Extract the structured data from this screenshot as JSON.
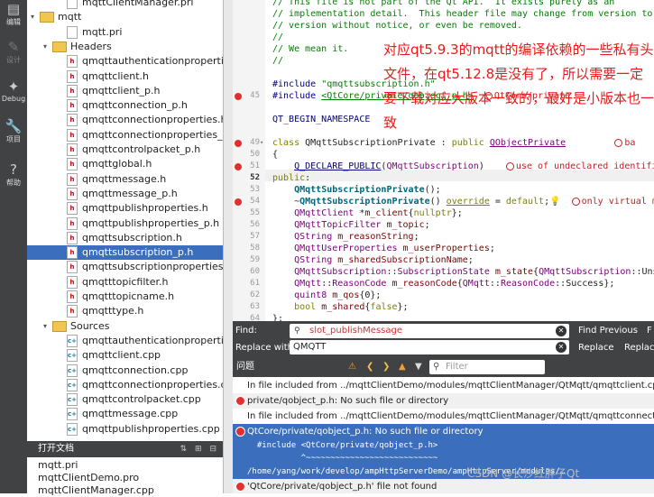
{
  "modebar": [
    {
      "label": "编辑",
      "icon": "▤"
    },
    {
      "label": "设计",
      "icon": "✎",
      "dim": true
    },
    {
      "label": "Debug",
      "icon": "✦"
    },
    {
      "label": "项目",
      "icon": "🔧"
    },
    {
      "label": "帮助",
      "icon": "?"
    }
  ],
  "tree": [
    {
      "text": "mqttClientManager.pri",
      "type": "pri",
      "indent": 3
    },
    {
      "text": "mqtt",
      "type": "folder",
      "indent": 1,
      "arrow": "▾"
    },
    {
      "text": "mqtt.pri",
      "type": "pri",
      "indent": 3
    },
    {
      "text": "Headers",
      "type": "folder",
      "indent": 2,
      "arrow": "▾"
    },
    {
      "text": "qmqttauthenticationproperties.h",
      "type": "h",
      "indent": 3
    },
    {
      "text": "qmqttclient.h",
      "type": "h",
      "indent": 3
    },
    {
      "text": "qmqttclient_p.h",
      "type": "h",
      "indent": 3
    },
    {
      "text": "qmqttconnection_p.h",
      "type": "h",
      "indent": 3
    },
    {
      "text": "qmqttconnectionproperties.h",
      "type": "h",
      "indent": 3
    },
    {
      "text": "qmqttconnectionproperties_p.h",
      "type": "h",
      "indent": 3
    },
    {
      "text": "qmqttcontrolpacket_p.h",
      "type": "h",
      "indent": 3
    },
    {
      "text": "qmqttglobal.h",
      "type": "h",
      "indent": 3
    },
    {
      "text": "qmqttmessage.h",
      "type": "h",
      "indent": 3
    },
    {
      "text": "qmqttmessage_p.h",
      "type": "h",
      "indent": 3
    },
    {
      "text": "qmqttpublishproperties.h",
      "type": "h",
      "indent": 3
    },
    {
      "text": "qmqttpublishproperties_p.h",
      "type": "h",
      "indent": 3
    },
    {
      "text": "qmqttsubscription.h",
      "type": "h",
      "indent": 3
    },
    {
      "text": "qmqttsubscription_p.h",
      "type": "h",
      "indent": 3,
      "selected": true
    },
    {
      "text": "qmqttsubscriptionproperties.h",
      "type": "h",
      "indent": 3
    },
    {
      "text": "qmqtttopicfilter.h",
      "type": "h",
      "indent": 3
    },
    {
      "text": "qmqtttopicname.h",
      "type": "h",
      "indent": 3
    },
    {
      "text": "qmqtttype.h",
      "type": "h",
      "indent": 3
    },
    {
      "text": "Sources",
      "type": "folder",
      "indent": 2,
      "arrow": "▾"
    },
    {
      "text": "qmqttauthenticationproperties.cpp",
      "type": "cpp",
      "indent": 3
    },
    {
      "text": "qmqttclient.cpp",
      "type": "cpp",
      "indent": 3
    },
    {
      "text": "qmqttconnection.cpp",
      "type": "cpp",
      "indent": 3
    },
    {
      "text": "qmqttconnectionproperties.cpp",
      "type": "cpp",
      "indent": 3
    },
    {
      "text": "qmqttcontrolpacket.cpp",
      "type": "cpp",
      "indent": 3
    },
    {
      "text": "qmqttmessage.cpp",
      "type": "cpp",
      "indent": 3
    },
    {
      "text": "qmqttpublishproperties.cpp",
      "type": "cpp",
      "indent": 3
    }
  ],
  "open_docs": {
    "title": "打开文档",
    "controls": "⇅ ⊞ ⊟",
    "items": [
      "mqtt.pri",
      "mqttClientDemo.pro",
      "mqttClientManager.cpp"
    ]
  },
  "editor": {
    "lines": [
      {
        "n": "",
        "html": "<span class='cm'>// This file is not part of the Qt API.  It exists purely as an</span>"
      },
      {
        "n": "",
        "html": "<span class='cm'>// implementation detail.  This header file may change from version to</span>"
      },
      {
        "n": "",
        "html": "<span class='cm'>// version without notice, or even be removed.</span>"
      },
      {
        "n": "",
        "html": "<span class='cm'>//</span>"
      },
      {
        "n": "",
        "html": "<span class='cm'>// We mean it.</span>"
      },
      {
        "n": "",
        "html": "<span class='cm'>//</span>"
      },
      {
        "n": "",
        "html": ""
      },
      {
        "n": "",
        "html": "<span class='mac'>#include</span> <span class='str'>\"qmqttsubscription.h\"</span>"
      },
      {
        "n": "45",
        "err": true,
        "html": "<span class='mac'>#include</span> <span class='str' style='text-decoration:underline'>&lt;QtCore/private/qobject_p.h&gt;</span>  <span class='dg'><span class='dgic'></span>QtCore/private</span>"
      },
      {
        "n": "",
        "html": ""
      },
      {
        "n": "",
        "html": "<span class='mac'>QT_BEGIN_NAMESPACE</span>"
      },
      {
        "n": "",
        "html": ""
      },
      {
        "n": "49",
        "err": true,
        "fold": true,
        "html": "<span class='kw'>class</span> QMqttSubscriptionPrivate : <span class='kw'>public</span> <span class='ty' style='text-decoration:underline'>QObjectPrivate</span>         <span class='dg'><span class='dgic'></span>ba</span>"
      },
      {
        "n": "50",
        "html": "{"
      },
      {
        "n": "51",
        "err": true,
        "html": "    <span class='mac' style='text-decoration:underline'>Q_DECLARE_PUBLIC</span>(<span class='ty'>QMqttSubscription</span>)    <span class='dg'><span class='dgic'></span>use of undeclared identifi</span>"
      },
      {
        "n": "52",
        "cur": true,
        "html": "<span class='kw'>public</span>:"
      },
      {
        "n": "53",
        "html": "    <span class='fn'>QMqttSubscriptionPrivate</span>();"
      },
      {
        "n": "54",
        "err": true,
        "html": "    ~<span class='fn'>QMqttSubscriptionPrivate</span>() <span class='kw' style='text-decoration:underline'>override</span> = <span class='kw'>default</span>;<span style='color:#c90'>💡</span>  <span class='dg'><span class='dgic'></span>only virtual m</span>"
      },
      {
        "n": "55",
        "html": "    <span class='ty'>QMqttClient</span> *<span class='mem'>m_client</span>{<span class='kw'>nullptr</span>};"
      },
      {
        "n": "56",
        "html": "    <span class='ty'>QMqttTopicFilter</span> <span class='mem'>m_topic</span>;"
      },
      {
        "n": "57",
        "html": "    <span class='ty'>QString</span> <span class='mem'>m_reasonString</span>;"
      },
      {
        "n": "58",
        "html": "    <span class='ty'>QMqttUserProperties</span> <span class='mem'>m_userProperties</span>;"
      },
      {
        "n": "59",
        "html": "    <span class='ty'>QString</span> <span class='mem'>m_sharedSubscriptionName</span>;"
      },
      {
        "n": "60",
        "html": "    <span class='ty'>QMqttSubscription</span>::<span class='ty'>SubscriptionState</span> <span class='mem'>m_state</span>{<span class='ty'>QMqttSubscription</span>::Unsu"
      },
      {
        "n": "61",
        "html": "    <span class='ty'>QMqtt</span>::<span class='ty'>ReasonCode</span> <span class='mem'>m_reasonCode</span>{<span class='ty'>QMqtt</span>::<span class='ty'>ReasonCode</span>::Success};"
      },
      {
        "n": "62",
        "html": "    <span class='ty'>quint8</span> <span class='mem'>m_qos</span>{0};"
      },
      {
        "n": "63",
        "html": "    <span class='kw'>bool</span> <span class='mem'>m_shared</span>{<span class='kw'>false</span>};"
      },
      {
        "n": "64",
        "html": "};"
      }
    ],
    "annotation": "对应qt5.9.3的mqtt的编译依赖的一些私有头文件，在qt5.12.8是没有了，所以需要一定要下载对应大版本一致的，最好是小版本也一致"
  },
  "find": {
    "find_label": "Find:",
    "find_value": "slot_publishMessage",
    "replace_label": "Replace with:",
    "replace_value": "QMQTT",
    "find_prev": "Find Previous",
    "find_next": "F",
    "replace": "Replace",
    "replace_all": "Replac"
  },
  "issues": {
    "title": "问题",
    "filter_placeholder": "Filter",
    "rows": [
      {
        "text": "In file included from ../mqttClientDemo/modules/mqttClientManager/QtMqtt/qmqttclient.cpp:31:0:",
        "kind": "info"
      },
      {
        "text": "private/qobject_p.h: No such file or directory",
        "kind": "error",
        "alt": true
      },
      {
        "text": "In file included from ../mqttClientDemo/modules/mqttClientManager/QtMqtt/qmqttconnection.cpp:31:0:",
        "kind": "info"
      },
      {
        "text": "QtCore/private/qobject_p.h: No such file or directory",
        "kind": "error",
        "selected": true
      },
      {
        "text": "  #include <QtCore/private/qobject_p.h>",
        "kind": "sub",
        "selected": true
      },
      {
        "text": "           ^~~~~~~~~~~~~~~~~~~~~~~~~~~~",
        "kind": "sub",
        "selected": true
      },
      {
        "text": "/home/yang/work/develop/ampHttpServerDemo/ampHttpServer/modules/…",
        "kind": "sub",
        "selected": true
      },
      {
        "text": "'QtCore/private/qobject_p.h' file not found",
        "kind": "error",
        "alt": true
      }
    ]
  },
  "watermark": "CSDN @长沙红胖子Qt"
}
